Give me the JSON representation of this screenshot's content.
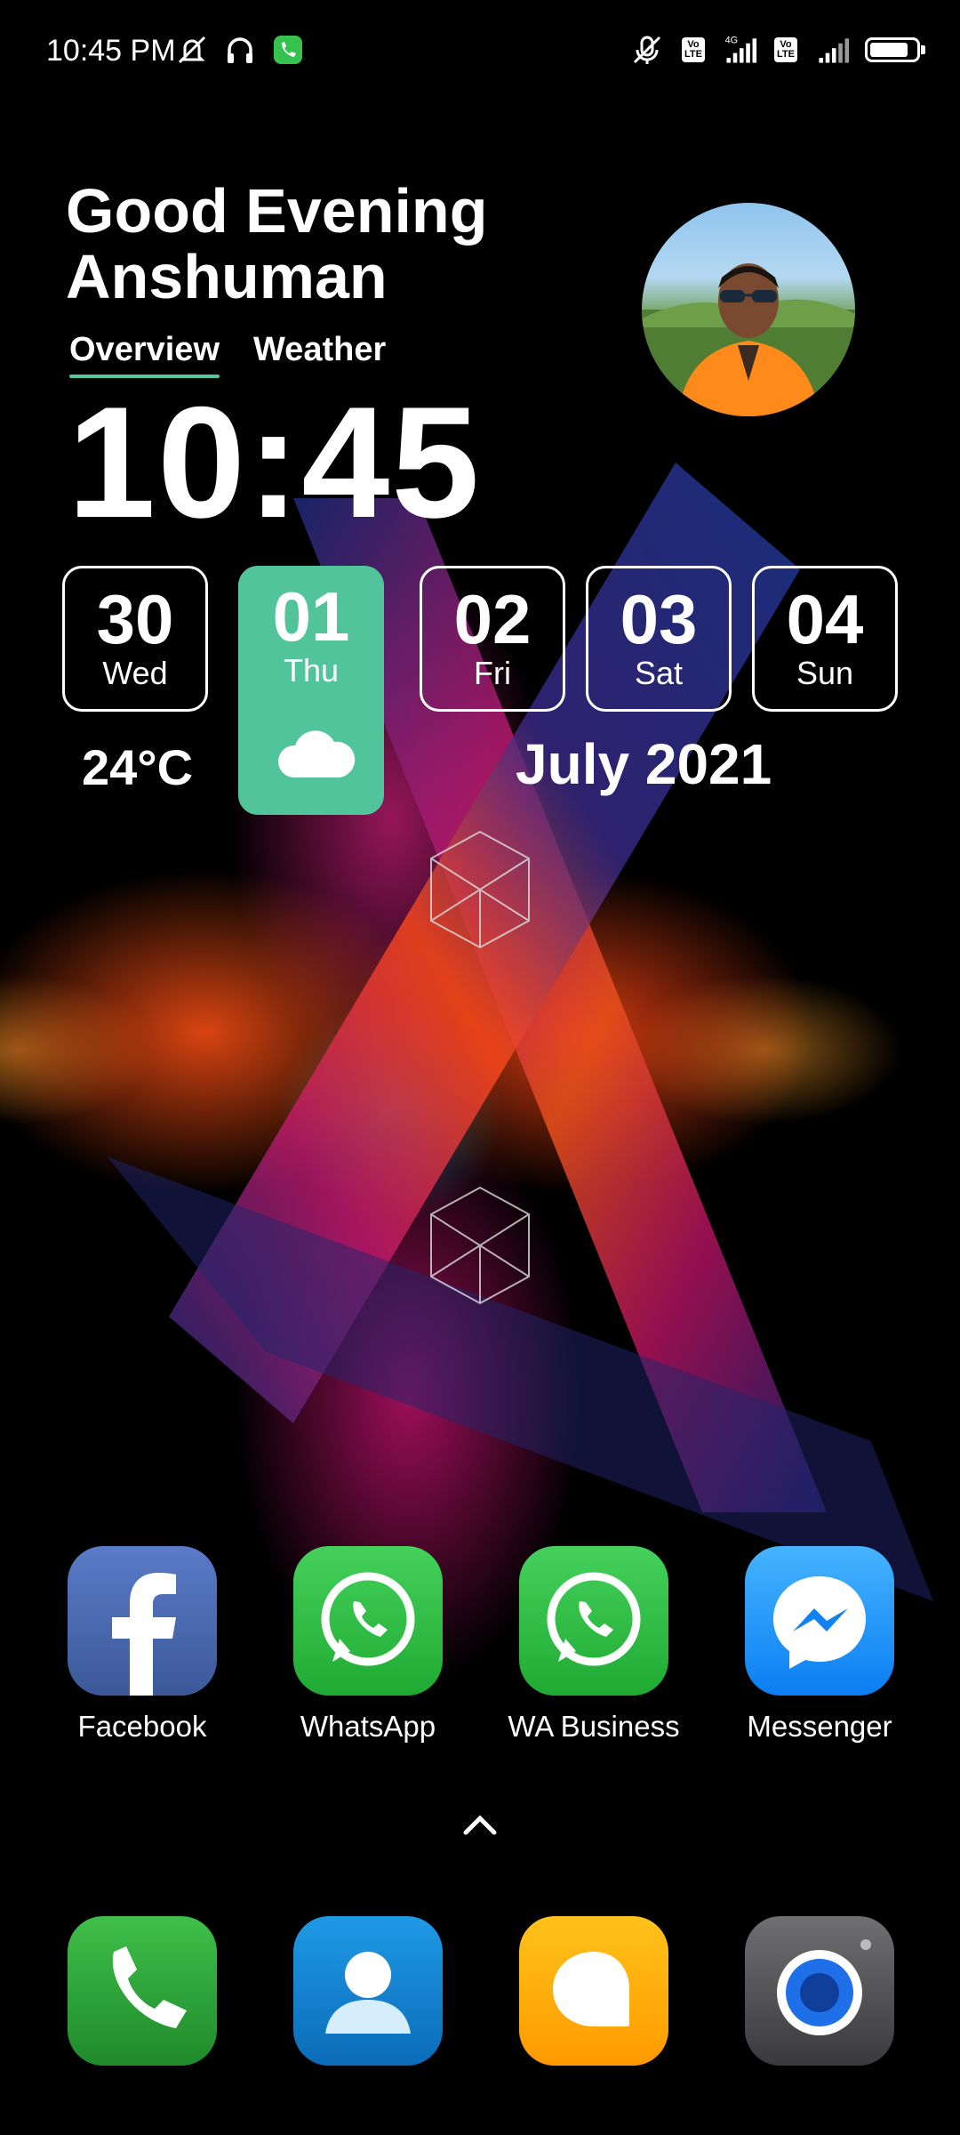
{
  "status_bar": {
    "time": "10:45 PM",
    "left_icons": [
      "mute-icon",
      "headset-icon",
      "call-active-icon"
    ],
    "right_icons": [
      "mic-off-icon",
      "volte-icon",
      "signal-4g-icon",
      "volte-icon",
      "signal-icon",
      "battery-icon"
    ],
    "volte_text": "Vo\nLTE",
    "network_label": "4G",
    "battery_level": 0.85
  },
  "widget": {
    "greeting_line1": "Good Evening",
    "greeting_line2": "Anshuman",
    "tabs": [
      {
        "label": "Overview",
        "active": true
      },
      {
        "label": "Weather",
        "active": false
      }
    ],
    "clock": "10:45",
    "days": [
      {
        "num": "30",
        "name": "Wed"
      },
      {
        "num": "01",
        "name": "Thu",
        "active": true
      },
      {
        "num": "02",
        "name": "Fri"
      },
      {
        "num": "03",
        "name": "Sat"
      },
      {
        "num": "04",
        "name": "Sun"
      }
    ],
    "weather_icon": "cloud-icon",
    "temperature": "24°C",
    "month_year": "July 2021",
    "accent_color": "#52c49b"
  },
  "apps": [
    {
      "label": "Facebook",
      "icon": "facebook-icon"
    },
    {
      "label": "WhatsApp",
      "icon": "whatsapp-icon"
    },
    {
      "label": "WA Business",
      "icon": "whatsapp-icon"
    },
    {
      "label": "Messenger",
      "icon": "messenger-icon"
    }
  ],
  "dock": [
    {
      "icon": "phone-icon"
    },
    {
      "icon": "contacts-icon"
    },
    {
      "icon": "messages-icon"
    },
    {
      "icon": "camera-icon"
    }
  ]
}
